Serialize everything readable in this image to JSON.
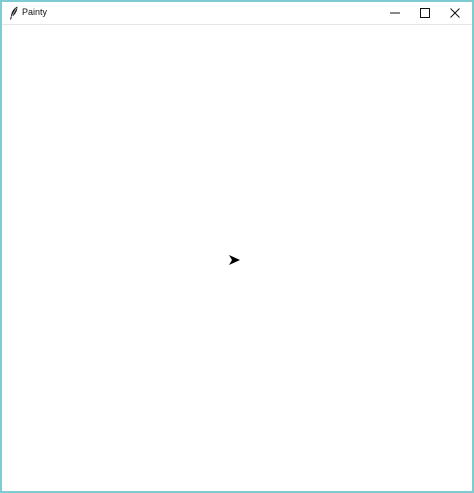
{
  "window": {
    "title": "Painty",
    "app_icon": "feather-icon",
    "controls": {
      "minimize": "minimize-icon",
      "maximize": "maximize-icon",
      "close": "close-icon"
    },
    "border_color": "#7ecbd2"
  },
  "canvas": {
    "background": "#ffffff",
    "cursor_icon": "turtle-arrow-icon"
  }
}
